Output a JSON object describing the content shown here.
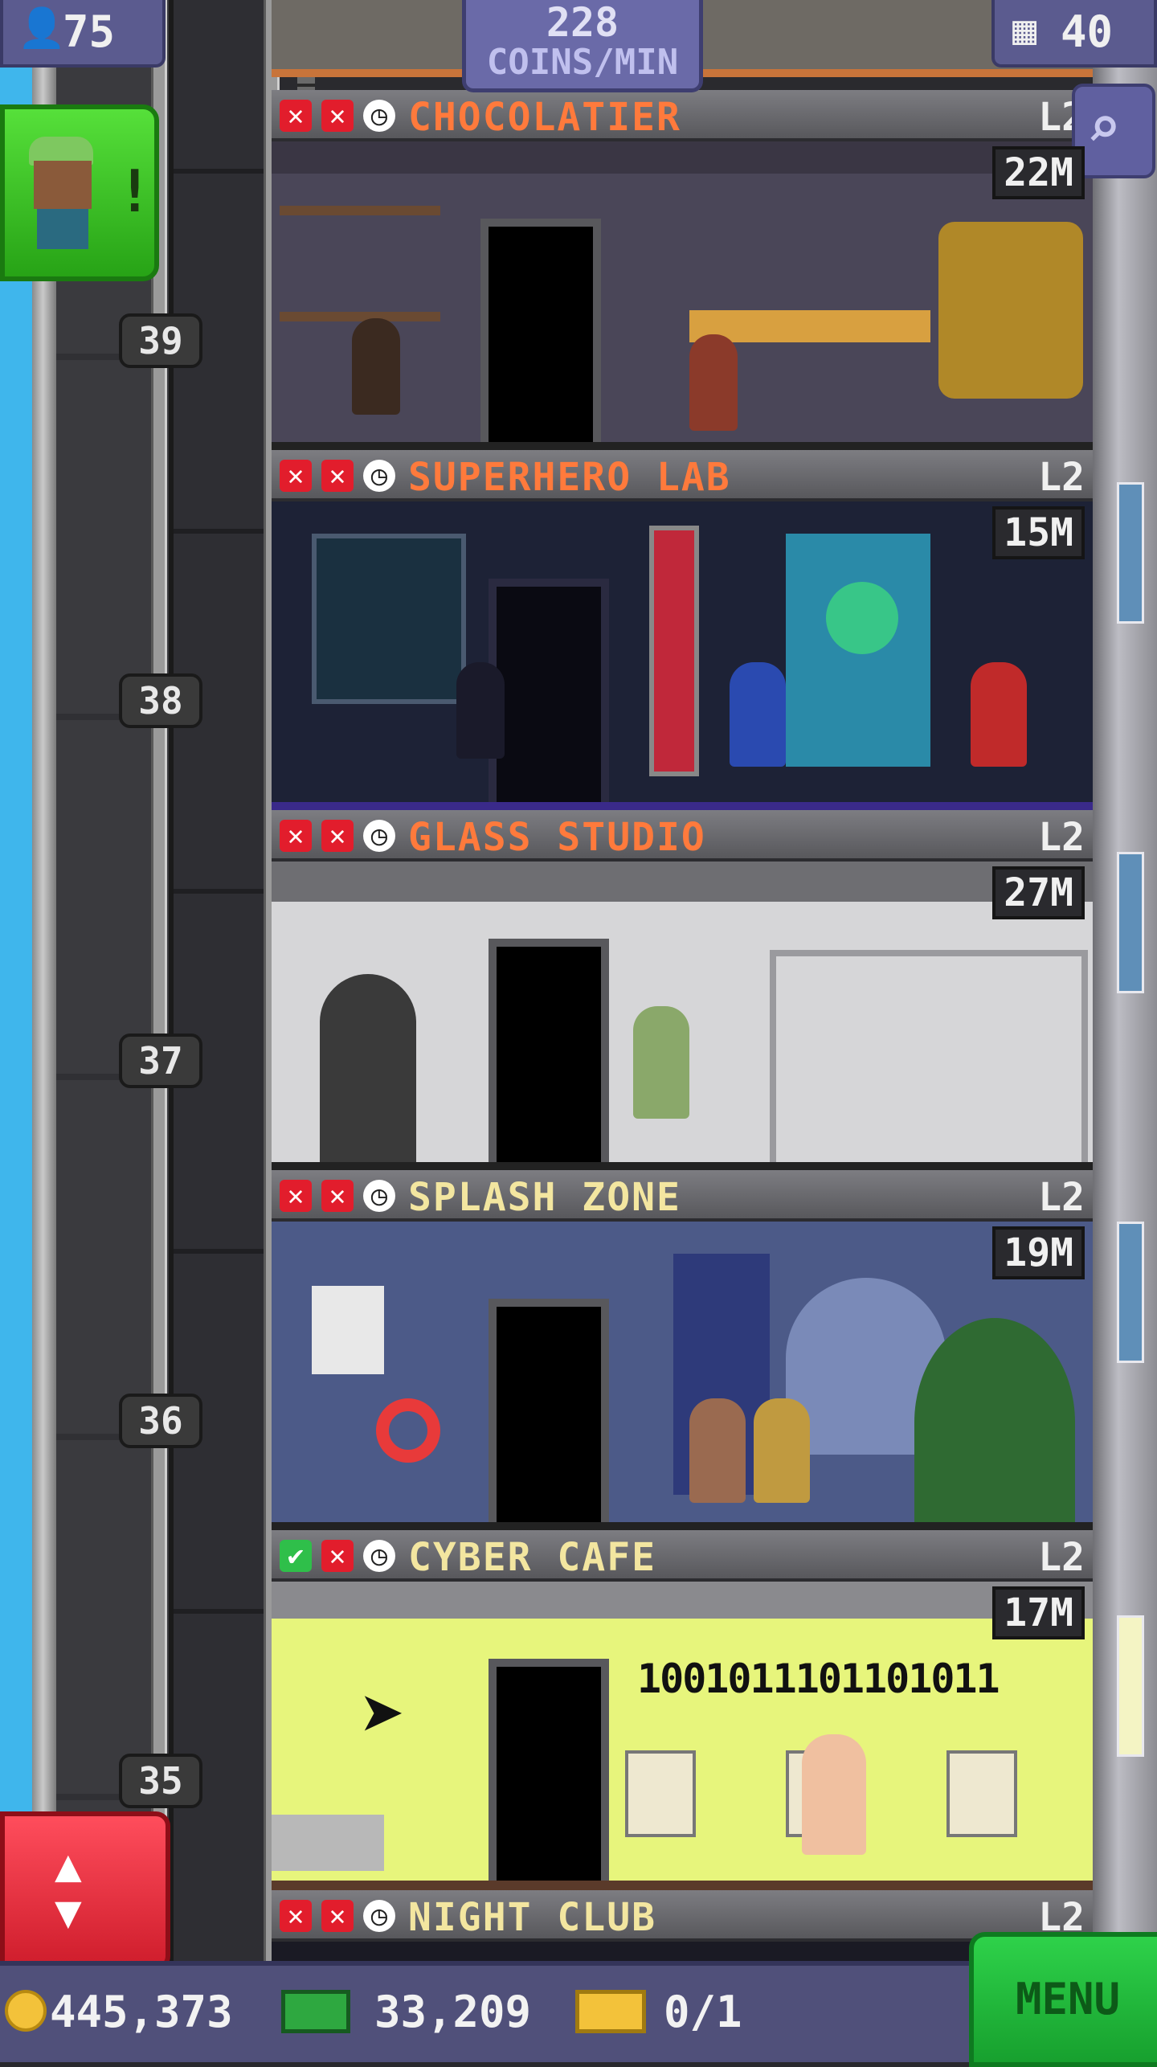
{
  "hud": {
    "population": "75",
    "coins_per_min_value": "228",
    "coins_per_min_label": "COINS/MIN",
    "floor_count": "40"
  },
  "floor_numbers": [
    "39",
    "38",
    "37",
    "36",
    "35"
  ],
  "floors": [
    {
      "name": "CHOCOLATIER",
      "level": "L2",
      "stock": "22M",
      "name_color": "#ff7a3c",
      "status": [
        "x",
        "x",
        "clock"
      ],
      "wall_color": "#4a4658"
    },
    {
      "name": "SUPERHERO LAB",
      "level": "L2",
      "stock": "15M",
      "name_color": "#ff7a3c",
      "status": [
        "x",
        "x",
        "clock"
      ],
      "wall_color": "#1d2236"
    },
    {
      "name": "GLASS STUDIO",
      "level": "L2",
      "stock": "27M",
      "name_color": "#ff7a3c",
      "status": [
        "x",
        "x",
        "clock"
      ],
      "wall_color": "#d6d6d8"
    },
    {
      "name": "SPLASH ZONE",
      "level": "L2",
      "stock": "19M",
      "name_color": "#f3e6a0",
      "status": [
        "x",
        "x",
        "clock"
      ],
      "wall_color": "#4c5a88"
    },
    {
      "name": "CYBER CAFE",
      "level": "L2",
      "stock": "17M",
      "name_color": "#f3e6a0",
      "status": [
        "check",
        "x",
        "clock"
      ],
      "wall_color": "#e7f57c"
    },
    {
      "name": "NIGHT CLUB",
      "level": "L2",
      "name_color": "#f3e6a0",
      "status": [
        "x",
        "x",
        "clock"
      ]
    }
  ],
  "cyber_cafe_binary": "1001011101101011",
  "bottom_bar": {
    "coins": "445,373",
    "bux": "33,209",
    "tickets": "0/1",
    "menu_label": "MENU"
  },
  "colors": {
    "status_x": "#e21d2c",
    "status_check": "#2fbf4a",
    "accent_green": "#2ed24a",
    "accent_red": "#ff4d5c"
  }
}
